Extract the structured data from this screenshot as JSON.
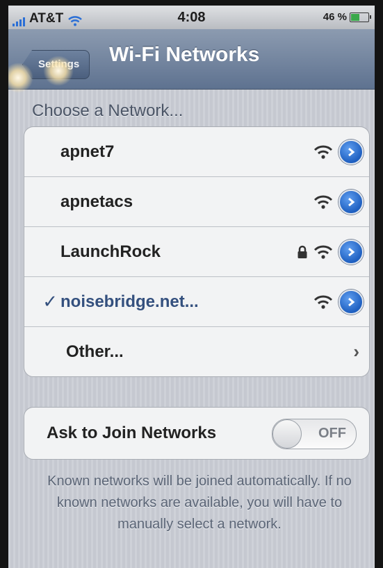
{
  "status_bar": {
    "carrier": "AT&T",
    "time": "4:08",
    "battery": "46 %"
  },
  "nav": {
    "back_label": "Settings",
    "title": "Wi-Fi Networks"
  },
  "section_header": "Choose a Network...",
  "networks": [
    {
      "name": "apnet7",
      "secured": false,
      "selected": false,
      "check": ""
    },
    {
      "name": "apnetacs",
      "secured": false,
      "selected": false,
      "check": ""
    },
    {
      "name": "LaunchRock",
      "secured": true,
      "selected": false,
      "check": ""
    },
    {
      "name": "noisebridge.net...",
      "secured": false,
      "selected": true,
      "check": "✓"
    }
  ],
  "other_label": "Other...",
  "ask_to_join": {
    "label": "Ask to Join Networks",
    "state": "OFF"
  },
  "footer": "Known networks will be joined automatically. If no known networks are available, you will have to manually select a network.",
  "icons": {
    "wifi": "wifi-signal-icon",
    "lock": "lock-icon",
    "detail": "detail-disclosure-icon",
    "chevron": "chevron-right-icon"
  },
  "colors": {
    "accent": "#34507e",
    "nav_bar": "#6d7f9a",
    "detail_button": "#2a6fd2"
  }
}
